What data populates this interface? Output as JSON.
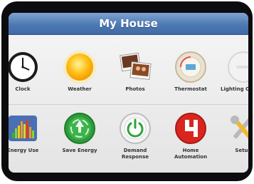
{
  "header": {
    "title": "My House"
  },
  "row1": [
    {
      "label": "Clock"
    },
    {
      "label": "Weather"
    },
    {
      "label": "Photos"
    },
    {
      "label": "Thermostat"
    },
    {
      "label": "Lighting Control"
    }
  ],
  "row2": [
    {
      "label": "Energy Use"
    },
    {
      "label": "Save Energy"
    },
    {
      "label": "Demand Response"
    },
    {
      "label": "Home Automation"
    },
    {
      "label": "Setup"
    }
  ],
  "colors": {
    "title_bar": "#4d79b3",
    "screen_bg": "#eeeeee",
    "bezel": "#0c0c0e"
  }
}
